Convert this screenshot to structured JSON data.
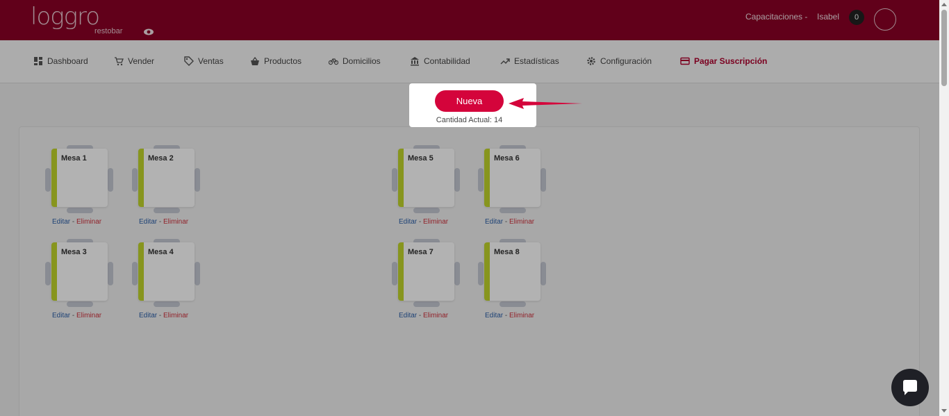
{
  "brand": {
    "name": "loggro",
    "sub": "restobar"
  },
  "header": {
    "company": "Capacitaciones -",
    "user": "Isabel",
    "notifications": "0"
  },
  "nav": [
    {
      "label": "Dashboard",
      "icon": "dashboard-icon"
    },
    {
      "label": "Vender",
      "icon": "cart-icon"
    },
    {
      "label": "Ventas",
      "icon": "tag-icon"
    },
    {
      "label": "Productos",
      "icon": "basket-icon"
    },
    {
      "label": "Domicilios",
      "icon": "bicycle-icon"
    },
    {
      "label": "Contabilidad",
      "icon": "bank-icon"
    },
    {
      "label": "Estadísticas",
      "icon": "trending-up-icon"
    },
    {
      "label": "Configuración",
      "icon": "gear-icon"
    },
    {
      "label": "Pagar Suscripción",
      "icon": "credit-card-icon"
    }
  ],
  "popup": {
    "button": "Nueva",
    "count_text": "Cantidad Actual: 14"
  },
  "tables": [
    {
      "label": "Mesa 1",
      "edit": "Editar",
      "sep": " - ",
      "delete": "Eliminar"
    },
    {
      "label": "Mesa 2",
      "edit": "Editar",
      "sep": " - ",
      "delete": "Eliminar"
    },
    {
      "label": "Mesa 5",
      "edit": "Editar",
      "sep": " - ",
      "delete": "Eliminar"
    },
    {
      "label": "Mesa 6",
      "edit": "Editar",
      "sep": " - ",
      "delete": "Eliminar"
    },
    {
      "label": "Mesa 3",
      "edit": "Editar",
      "sep": " - ",
      "delete": "Eliminar"
    },
    {
      "label": "Mesa 4",
      "edit": "Editar",
      "sep": " - ",
      "delete": "Eliminar"
    },
    {
      "label": "Mesa 7",
      "edit": "Editar",
      "sep": " - ",
      "delete": "Eliminar"
    },
    {
      "label": "Mesa 8",
      "edit": "Editar",
      "sep": " - ",
      "delete": "Eliminar"
    }
  ],
  "colors": {
    "brand": "#8c0026",
    "accent": "#d4043b",
    "table_status": "#c2d62b"
  }
}
